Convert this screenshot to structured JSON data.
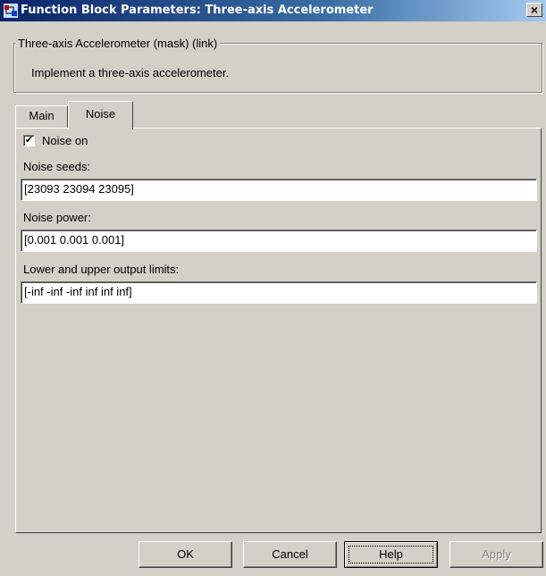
{
  "window": {
    "title": "Function Block Parameters: Three-axis Accelerometer",
    "close_glyph": "×"
  },
  "mask": {
    "group_title": "Three-axis Accelerometer (mask) (link)",
    "description": "Implement a three-axis accelerometer."
  },
  "tabs": [
    {
      "label": "Main",
      "selected": false
    },
    {
      "label": "Noise",
      "selected": true
    }
  ],
  "noise": {
    "noise_on_label": "Noise on",
    "noise_on_checked": true,
    "check_glyph": "✔",
    "seeds_label": "Noise seeds:",
    "seeds_value": "[23093 23094 23095]",
    "power_label": "Noise power:",
    "power_value": "[0.001 0.001 0.001]",
    "limits_label": "Lower and upper output limits:",
    "limits_value": "[-inf  -inf  -inf  inf inf inf]"
  },
  "buttons": {
    "ok": "OK",
    "cancel": "Cancel",
    "help": "Help",
    "apply": "Apply"
  },
  "icons": {
    "app": "simulink-block-icon",
    "close": "close-icon",
    "check": "checkmark-icon"
  }
}
